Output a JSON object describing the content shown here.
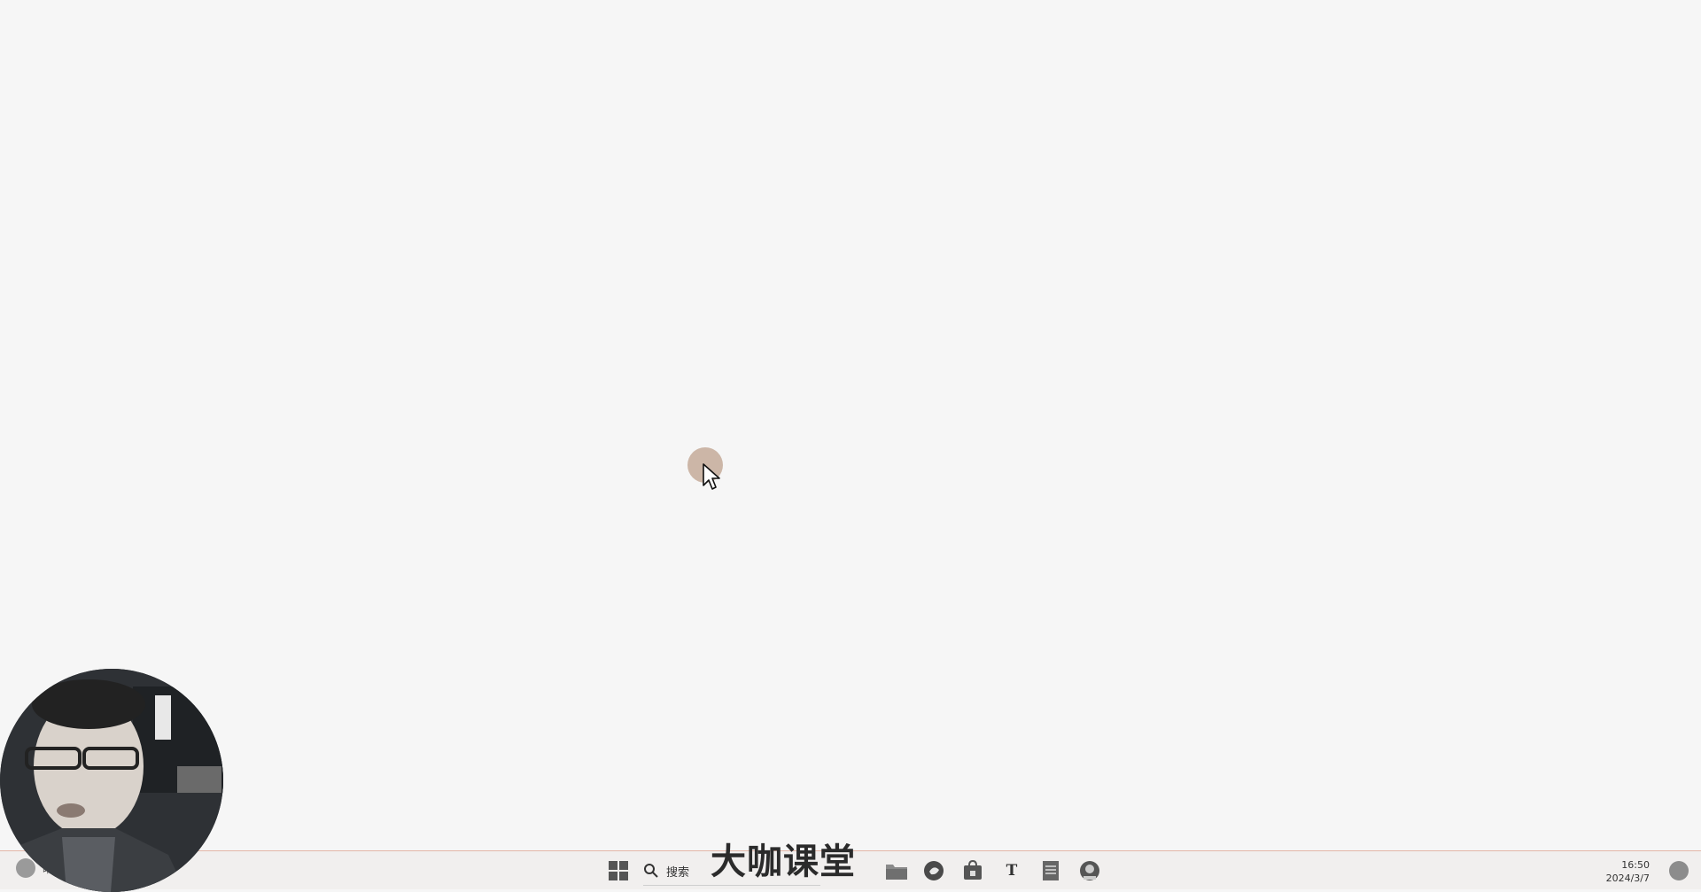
{
  "taskbar": {
    "weather_label": "晴",
    "search_label": "搜索",
    "time": "16:50",
    "date": "2024/3/7",
    "items": [
      {
        "name": "start-icon"
      },
      {
        "name": "search-icon"
      },
      {
        "name": "file-explorer-icon"
      },
      {
        "name": "edge-browser-icon"
      },
      {
        "name": "store-icon"
      },
      {
        "name": "text-app-icon",
        "glyph": "T"
      },
      {
        "name": "notepad-icon"
      },
      {
        "name": "dev-app-icon"
      }
    ]
  },
  "watermark": {
    "text": "大咖课堂"
  },
  "colors": {
    "desktop_bg": "#f6f6f6",
    "taskbar_bg": "#f1efee",
    "cursor_highlight": "#bea08c"
  }
}
